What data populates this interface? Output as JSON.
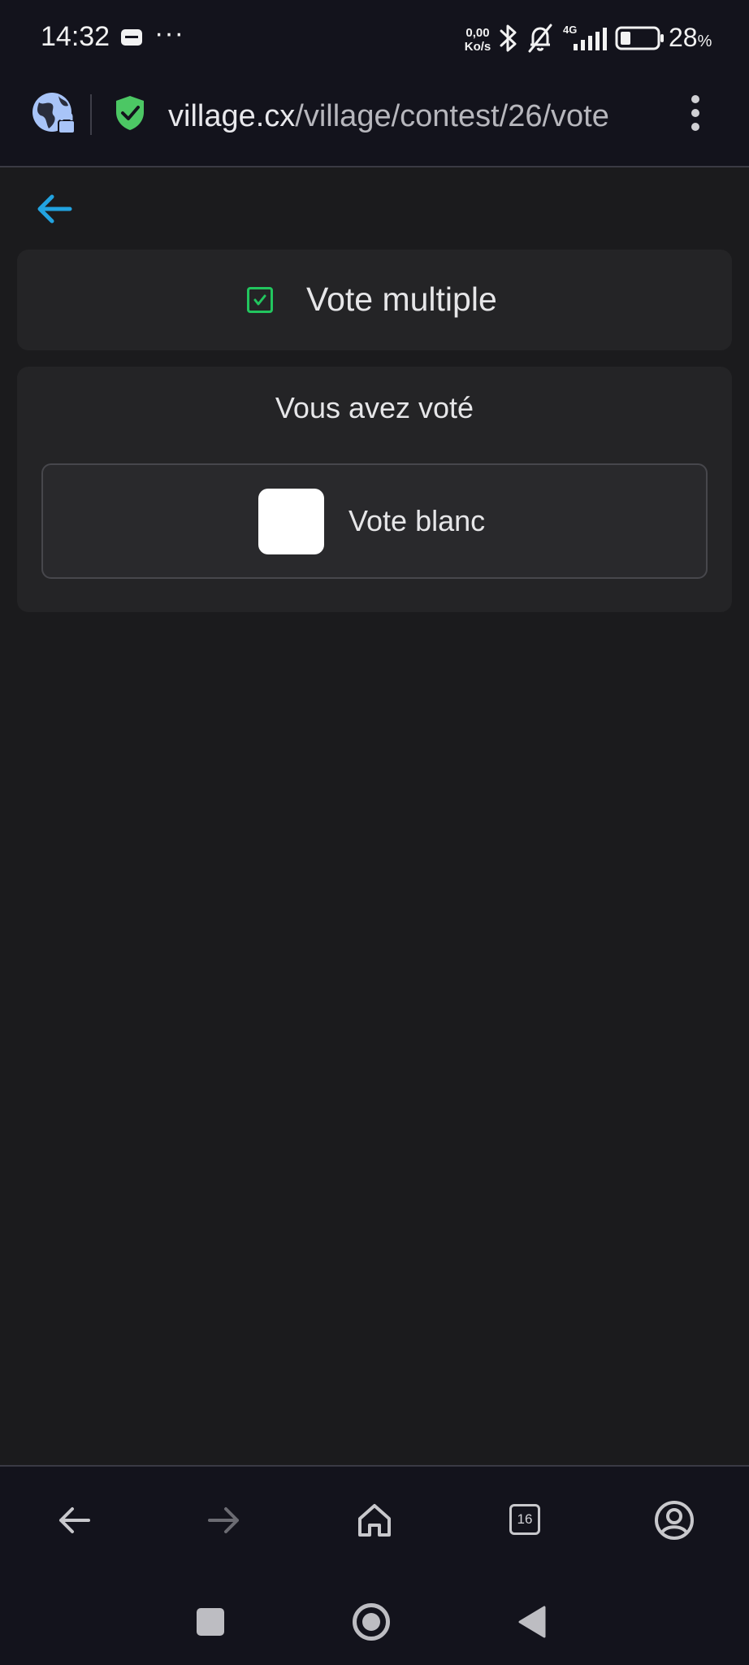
{
  "status_bar": {
    "time": "14:32",
    "dots": "···",
    "net_speed_value": "0,00",
    "net_speed_unit": "Ko/s",
    "network_type": "4G",
    "battery_value": "28",
    "battery_unit": "%",
    "icons": [
      "sim-card-icon",
      "bluetooth-icon",
      "bell-off-icon",
      "signal-icon",
      "battery-icon"
    ]
  },
  "browser": {
    "url_host": "village.cx",
    "url_path": "/village/contest/26/vote",
    "icons": [
      "site-info-icon",
      "shield-check-icon",
      "overflow-menu-icon"
    ]
  },
  "page": {
    "header_title": "Vote multiple",
    "votes_title": "Vous avez voté",
    "options": [
      {
        "label": "Vote blanc",
        "color": "#ffffff"
      }
    ]
  },
  "bottom_nav": {
    "tabs_count": "16",
    "icons": [
      "back-icon",
      "forward-icon",
      "home-icon",
      "tabs-icon",
      "account-icon"
    ]
  },
  "system_nav": {
    "icons": [
      "recents-icon",
      "home-icon",
      "back-icon"
    ]
  },
  "colors": {
    "accent_check": "#22c55e",
    "back_arrow": "#22a3e0",
    "shield": "#4cc764",
    "site_info": "#a8c4f8",
    "background": "#1b1b1d",
    "card": "#242426"
  }
}
